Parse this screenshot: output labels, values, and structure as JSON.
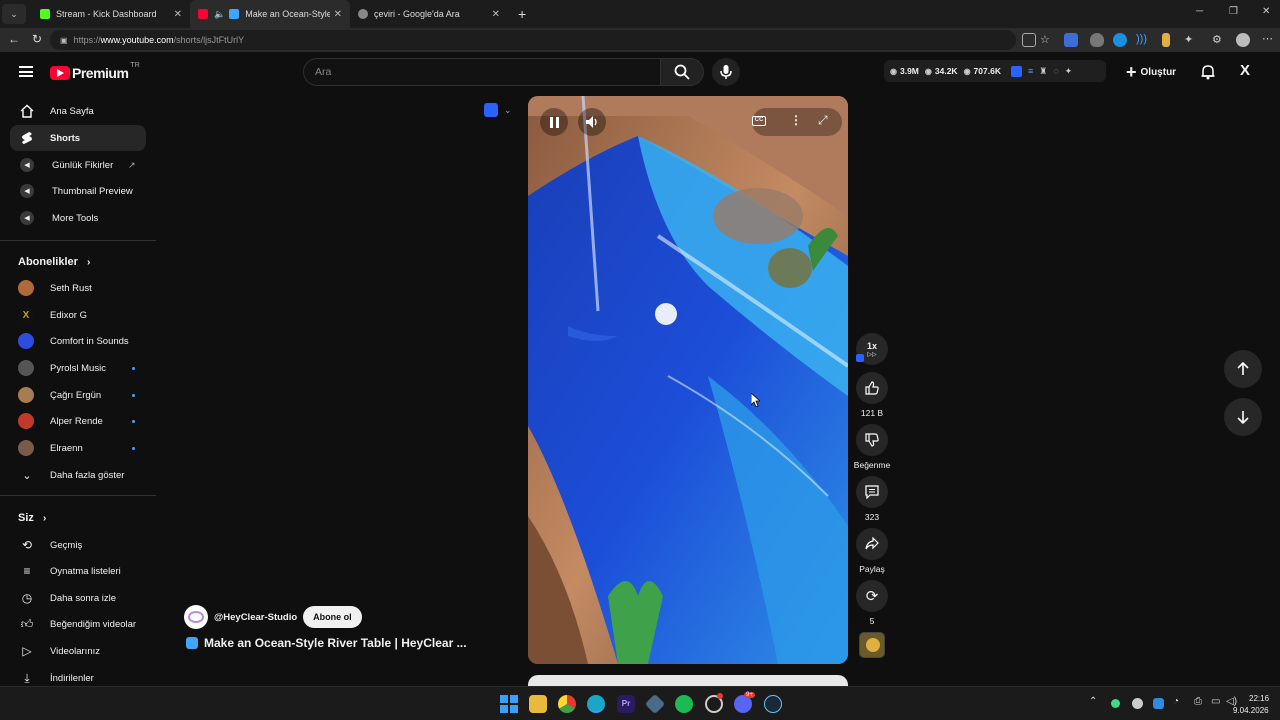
{
  "browser": {
    "tabs": [
      {
        "label": "Stream - Kick Dashboard",
        "color": "#53fc18"
      },
      {
        "label": "Make an Ocean-Style River Table",
        "color": "#ff0033"
      },
      {
        "label": "çeviri - Google'da Ara",
        "color": "#888888"
      }
    ],
    "url_prefix": "https://",
    "url_domain": "www.youtube.com",
    "url_path": "/shorts/ljsJtFtUrlY"
  },
  "header": {
    "logo_text": "Premium",
    "country": "TR",
    "search_placeholder": "Ara",
    "create_label": "Oluştur",
    "stats": {
      "views_total": "3.9M",
      "views_recent": "34.2K",
      "views_other": "707.6K"
    }
  },
  "sidebar": {
    "main": [
      {
        "label": "Ana Sayfa",
        "icon": "home-icon"
      },
      {
        "label": "Shorts",
        "icon": "shorts-icon",
        "active": true
      },
      {
        "label": "Günlük Fikirler",
        "icon": "extension-icon"
      },
      {
        "label": "Thumbnail Preview",
        "icon": "extension-icon"
      },
      {
        "label": "More Tools",
        "icon": "extension-icon"
      }
    ],
    "subs_title": "Abonelikler",
    "subs": [
      {
        "label": "Seth Rust",
        "color": "#b06a3a",
        "dot": false
      },
      {
        "label": "Edixor G",
        "color": "#c2a31a",
        "dot": false
      },
      {
        "label": "Comfort in Sounds",
        "color": "#2d4de0",
        "dot": false
      },
      {
        "label": "Pyrolsl Music",
        "color": "#666666",
        "dot": true
      },
      {
        "label": "Çağrı Ergün",
        "color": "#a67c52",
        "dot": true
      },
      {
        "label": "Alper Rende",
        "color": "#c0392b",
        "dot": true
      },
      {
        "label": "Elraenn",
        "color": "#7a5a48",
        "dot": true
      }
    ],
    "show_more": "Daha fazla göster",
    "you_title": "Siz",
    "you": [
      {
        "label": "Geçmiş",
        "icon": "history-icon"
      },
      {
        "label": "Oynatma listeleri",
        "icon": "playlists-icon"
      },
      {
        "label": "Daha sonra izle",
        "icon": "watch-later-icon"
      },
      {
        "label": "Beğendiğim videolar",
        "icon": "liked-icon"
      },
      {
        "label": "Videolarınız",
        "icon": "your-videos-icon"
      },
      {
        "label": "İndirilenler",
        "icon": "downloads-icon"
      }
    ]
  },
  "short": {
    "channel": "@HeyClear-Studio",
    "subscribe": "Abone ol",
    "title": "Make an Ocean-Style River Table | HeyClear ...",
    "speed": "1x",
    "likes": "121 B",
    "dislike_label": "Beğenme",
    "comments": "323",
    "share_label": "Paylaş",
    "remix_count": "5"
  },
  "taskbar": {
    "time": "22:16",
    "date": "9.04.2026",
    "discord_badge": "9+"
  }
}
